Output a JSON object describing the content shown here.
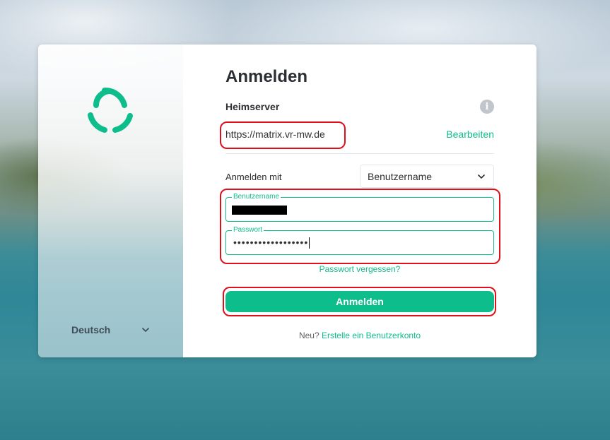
{
  "sidebar": {
    "logo_icon": "element-logo-icon",
    "language": "Deutsch",
    "language_icon": "chevron-down-icon"
  },
  "login": {
    "title": "Anmelden",
    "homeserver_label": "Heimserver",
    "info_icon": "info-icon",
    "info_glyph": "i",
    "homeserver_url": "https://matrix.vr-mw.de",
    "edit_label": "Bearbeiten",
    "login_with_label": "Anmelden mit",
    "login_with_value": "Benutzername",
    "username_label": "Benutzername",
    "username_value_redacted": true,
    "password_label": "Passwort",
    "password_value": "••••••••••••••••••",
    "forgot_password": "Passwort vergessen?",
    "submit_label": "Anmelden",
    "register_prefix": "Neu?",
    "register_link": "Erstelle ein Benutzerkonto"
  },
  "colors": {
    "accent": "#0dbd8b",
    "highlight": "#e0101b"
  }
}
